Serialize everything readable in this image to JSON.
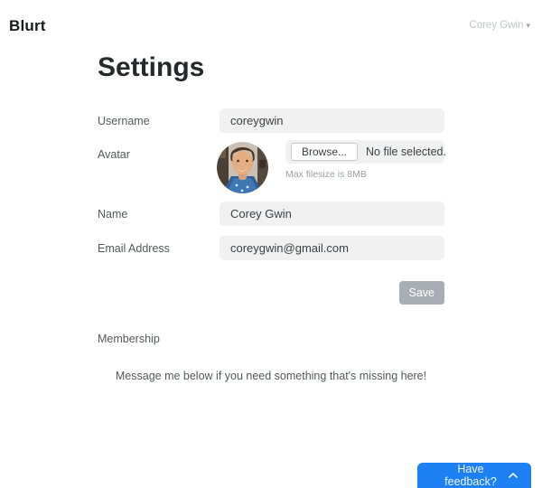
{
  "header": {
    "brand": "Blurt",
    "user_menu": {
      "name": "Corey Gwin",
      "caret": "▾"
    }
  },
  "page": {
    "title": "Settings"
  },
  "form": {
    "username": {
      "label": "Username",
      "value": "coreygwin"
    },
    "avatar": {
      "label": "Avatar",
      "browse_label": "Browse...",
      "no_file_text": "No file selected.",
      "helper": "Max filesize is 8MB",
      "image_alt": "avatar-photo"
    },
    "name": {
      "label": "Name",
      "value": "Corey Gwin"
    },
    "email": {
      "label": "Email Address",
      "value": "coreygwin@gmail.com"
    },
    "save_label": "Save"
  },
  "membership": {
    "label": "Membership",
    "message": "Message me below if you need something that's missing here!"
  },
  "feedback": {
    "label": "Have feedback?"
  },
  "colors": {
    "accent_blue": "#1e81f3",
    "save_gray": "#a9aeb4",
    "input_bg": "#f1f1f2",
    "label_gray": "#54585d",
    "muted_gray": "#9b9fa5"
  }
}
